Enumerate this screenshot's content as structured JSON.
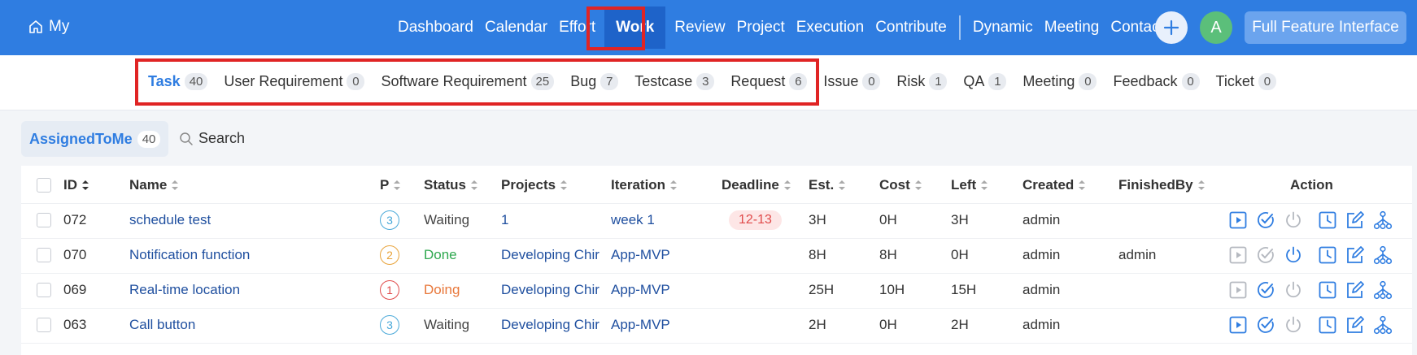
{
  "topbar": {
    "home_label": "My",
    "nav": [
      "Dashboard",
      "Calendar",
      "Effort",
      "Work",
      "Review",
      "Project",
      "Execution",
      "Contribute",
      "Dynamic",
      "Meeting",
      "Contacts"
    ],
    "avatar_letter": "A",
    "full_feature_label": "Full Feature Interface"
  },
  "subtabs": [
    {
      "label": "Task",
      "count": "40"
    },
    {
      "label": "User Requirement",
      "count": "0"
    },
    {
      "label": "Software Requirement",
      "count": "25"
    },
    {
      "label": "Bug",
      "count": "7"
    },
    {
      "label": "Testcase",
      "count": "3"
    },
    {
      "label": "Request",
      "count": "6"
    },
    {
      "label": "Issue",
      "count": "0"
    },
    {
      "label": "Risk",
      "count": "1"
    },
    {
      "label": "QA",
      "count": "1"
    },
    {
      "label": "Meeting",
      "count": "0"
    },
    {
      "label": "Feedback",
      "count": "0"
    },
    {
      "label": "Ticket",
      "count": "0"
    }
  ],
  "filter": {
    "label": "AssignedToMe",
    "count": "40",
    "search_label": "Search"
  },
  "table": {
    "headers": {
      "id": "ID",
      "name": "Name",
      "p": "P",
      "status": "Status",
      "projects": "Projects",
      "iteration": "Iteration",
      "deadline": "Deadline",
      "est": "Est.",
      "cost": "Cost",
      "left": "Left",
      "created": "Created",
      "finishedby": "FinishedBy",
      "action": "Action"
    },
    "rows": [
      {
        "id": "072",
        "name": "schedule test",
        "p": "3",
        "status": "Waiting",
        "projects": "1",
        "iteration": "week 1",
        "deadline": "12-13",
        "est": "3H",
        "cost": "0H",
        "left": "3H",
        "created": "admin",
        "finishedby": ""
      },
      {
        "id": "070",
        "name": "Notification function",
        "p": "2",
        "status": "Done",
        "projects": "Developing Chir",
        "iteration": "App-MVP",
        "deadline": "",
        "est": "8H",
        "cost": "8H",
        "left": "0H",
        "created": "admin",
        "finishedby": "admin"
      },
      {
        "id": "069",
        "name": "Real-time location",
        "p": "1",
        "status": "Doing",
        "projects": "Developing Chir",
        "iteration": "App-MVP",
        "deadline": "",
        "est": "25H",
        "cost": "10H",
        "left": "15H",
        "created": "admin",
        "finishedby": ""
      },
      {
        "id": "063",
        "name": "Call button",
        "p": "3",
        "status": "Waiting",
        "projects": "Developing Chir",
        "iteration": "App-MVP",
        "deadline": "",
        "est": "2H",
        "cost": "0H",
        "left": "2H",
        "created": "admin",
        "finishedby": ""
      }
    ]
  },
  "colors": {
    "primary": "#2f7de1",
    "waiting": "#444444",
    "done": "#2fa84f",
    "doing": "#e8773a",
    "p1": "#e04a4a",
    "p2": "#e8a33a",
    "p3": "#4aa9d9",
    "highlight": "#e02424"
  },
  "icons": [
    "home-icon",
    "plus-icon",
    "search-icon",
    "play-icon",
    "check-circle-icon",
    "power-icon",
    "clock-icon",
    "edit-icon",
    "branch-icon"
  ]
}
